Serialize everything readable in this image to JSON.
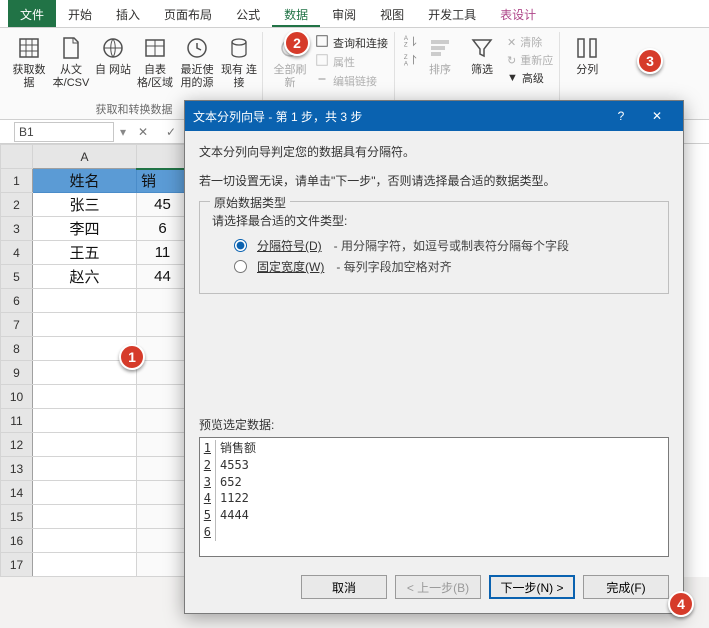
{
  "ribbon": {
    "tabs": {
      "file": "文件",
      "home": "开始",
      "insert": "插入",
      "pagelayout": "页面布局",
      "formulas": "公式",
      "data": "数据",
      "review": "审阅",
      "view": "视图",
      "devtools": "开发工具",
      "tabledesign": "表设计"
    },
    "groups": {
      "get_transform": "获取和转换数据"
    },
    "buttons": {
      "get_data": "获取数\n据",
      "from_csv": "从文\n本/CSV",
      "from_web": "自\n网站",
      "from_table": "自表\n格/区域",
      "recent": "最近使\n用的源",
      "exist_conn": "现有\n连接",
      "refresh_all": "全部刷新",
      "queries": "查询和连接",
      "properties": "属性",
      "edit_links": "编辑链接",
      "sort_asc": "",
      "sort_desc": "",
      "sort": "排序",
      "filter": "筛选",
      "clear": "清除",
      "reapply": "重新应",
      "advanced": "高级",
      "columns": "分列"
    }
  },
  "formula_bar": {
    "name_box": "B1"
  },
  "sheet": {
    "colA_label": "A",
    "header_name": "姓名",
    "header_sales_partial": "销",
    "rows": {
      "r2": {
        "name": "张三",
        "b": "45"
      },
      "r3": {
        "name": "李四",
        "b": "6"
      },
      "r4": {
        "name": "王五",
        "b": "11"
      },
      "r5": {
        "name": "赵六",
        "b": "44"
      }
    }
  },
  "dialog": {
    "title": "文本分列向导 - 第 1 步，共 3 步",
    "help": "?",
    "line1": "文本分列向导判定您的数据具有分隔符。",
    "line2": "若一切设置无误，请单击\"下一步\"，否则请选择最合适的数据类型。",
    "legend": "原始数据类型",
    "prompt": "请选择最合适的文件类型:",
    "opt_delim_label": "分隔符号(D)",
    "opt_delim_desc": "- 用分隔字符，如逗号或制表符分隔每个字段",
    "opt_fixed_label": "固定宽度(W)",
    "opt_fixed_desc": "- 每列字段加空格对齐",
    "preview_label": "预览选定数据:",
    "preview_lines": {
      "l1": "销售额",
      "l2": "4553",
      "l3": "652",
      "l4": "1122",
      "l5": "4444",
      "l6": ""
    },
    "buttons": {
      "cancel": "取消",
      "back": "< 上一步(B)",
      "next": "下一步(N) >",
      "finish": "完成(F)"
    }
  },
  "badges": {
    "n1": "1",
    "n2": "2",
    "n3": "3",
    "n4": "4"
  }
}
